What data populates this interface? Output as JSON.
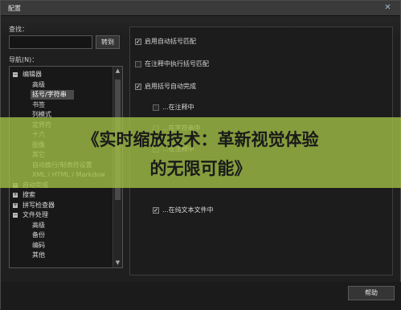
{
  "window": {
    "title": "配置"
  },
  "search": {
    "label": "查找：",
    "value": "",
    "button": "转到"
  },
  "nav": {
    "label": "导航(N)：",
    "items": [
      {
        "text": "编辑器",
        "expander": "minus"
      },
      {
        "text": "高级",
        "expander": ""
      },
      {
        "text": "括号/字符串",
        "expander": "",
        "selected": true
      },
      {
        "text": "书签",
        "expander": ""
      },
      {
        "text": "列模式",
        "expander": ""
      },
      {
        "text": "定界符",
        "expander": ""
      },
      {
        "text": "十六",
        "expander": ""
      },
      {
        "text": "图像",
        "expander": ""
      },
      {
        "text": "其它",
        "expander": ""
      },
      {
        "text": "自动换行/制表符设置",
        "expander": ""
      },
      {
        "text": "XML / HTML / Markdow",
        "expander": ""
      },
      {
        "text": "自动完成",
        "expander": "plus"
      },
      {
        "text": "搜索",
        "expander": "plus"
      },
      {
        "text": "拼写检查器",
        "expander": "plus"
      },
      {
        "text": "文件处理",
        "expander": "minus"
      },
      {
        "text": "高级",
        "expander": ""
      },
      {
        "text": "备份",
        "expander": ""
      },
      {
        "text": "编码",
        "expander": ""
      },
      {
        "text": "其他",
        "expander": ""
      }
    ],
    "scroll_up": "▲",
    "scroll_down": "▼"
  },
  "options": [
    {
      "label": "启用自动括号匹配",
      "checked": true
    },
    {
      "label": "在注释中执行括号匹配",
      "checked": false
    },
    {
      "label": "启用括号自动完成",
      "checked": true
    },
    {
      "label": "...在注释中",
      "checked": false
    },
    {
      "label": "...在字符串中",
      "checked": false
    },
    {
      "label": "...在注释中",
      "checked": false
    },
    {
      "label": "...在纯文本文件中",
      "checked": true
    }
  ],
  "help_button": "帮助",
  "banner": {
    "line1": "《实时缩放技术：革新视觉体验",
    "line2": "的无限可能》",
    "color": "#a0be46"
  },
  "icons": {
    "close": "close-icon",
    "check": "check-icon",
    "expand": "tree-expander-icon"
  }
}
